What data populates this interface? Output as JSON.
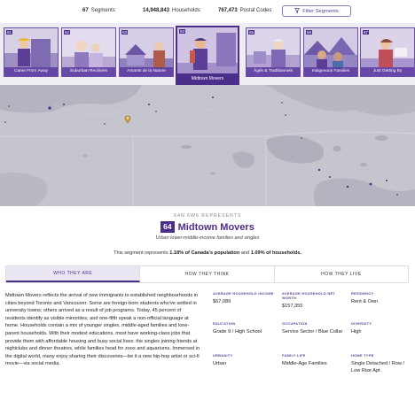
{
  "stats": {
    "segments_value": "67",
    "segments_label": "Segments",
    "households_value": "14,948,843",
    "households_label": "Households",
    "postal_value": "767,473",
    "postal_label": "Postal Codes",
    "filter_label": "Filter Segments"
  },
  "segment_cards": [
    {
      "num": "61",
      "name": "Came From Away"
    },
    {
      "num": "62",
      "name": "Suburban Recliners"
    },
    {
      "num": "63",
      "name": "Amants de la Nature"
    },
    {
      "num": "64",
      "name": "Midtown Movers"
    },
    {
      "num": "65",
      "name": "Âgés & Traditionnels"
    },
    {
      "num": "66",
      "name": "Indigenous Families"
    },
    {
      "num": "67",
      "name": "Just Getting By"
    }
  ],
  "segment": {
    "kicker": "S4N 6W6 REPRESENTS",
    "number": "64",
    "name": "Midtown Movers",
    "subtitle": "Urban lower-middle-income families and singles",
    "represents_prefix": "This segment represents",
    "represents_population": "1.18% of Canada's population",
    "represents_and": "and",
    "represents_households": "1.09% of households."
  },
  "tabs": [
    "WHO THEY ARE",
    "HOW THEY THINK",
    "HOW THEY LIVE"
  ],
  "description": "Midtown Movers reflects the arrival of new immigrants to established neighbourhoods in cities beyond Toronto and Vancouver. Some are foreign-born students who've settled in university towns; others arrived as a result of job programs. Today, 45 percent of residents identify as visible minorities; and one-fifth speak a non-official language at home. Households contain a mix of younger singles, middle-aged families and lone-parent households. With their modest educations, most have working-class jobs that provide them with affordable housing and busy social lives: the singles joining friends at nightclubs and dinner theatres, while families head for zoos and aquariums. Immersed in the digital world, many enjoy sharing their discoveries—be it a new hip-hop artist or sci-fi movie—via social media.",
  "facts": [
    {
      "label": "AVERAGE HOUSEHOLD INCOME",
      "value": "$67,089"
    },
    {
      "label": "AVERAGE HOUSEHOLD NET WORTH",
      "value": "$157,355"
    },
    {
      "label": "RESIDENCY",
      "value": "Rent & Own"
    },
    {
      "label": "EDUCATION",
      "value": "Grade 9 / High School"
    },
    {
      "label": "OCCUPATION",
      "value": "Service Sector / Blue Collar"
    },
    {
      "label": "DIVERSITY",
      "value": "High"
    },
    {
      "label": "URBANITY",
      "value": "Urban"
    },
    {
      "label": "FAMILY LIFE",
      "value": "Middle-Age Families"
    },
    {
      "label": "HOME TYPE",
      "value": "Single Detached / Row / Low Rise Apt"
    }
  ],
  "colors": {
    "brand_purple": "#4b2e8a",
    "accent_purple": "#5b3f96",
    "map_land": "#c4c4cc",
    "map_water": "#b0b0bc",
    "map_marker": "#4b2e8a",
    "location_marker": "#e8a33a"
  },
  "icons": {
    "filter": "filter-icon",
    "location": "location-pin-icon"
  }
}
